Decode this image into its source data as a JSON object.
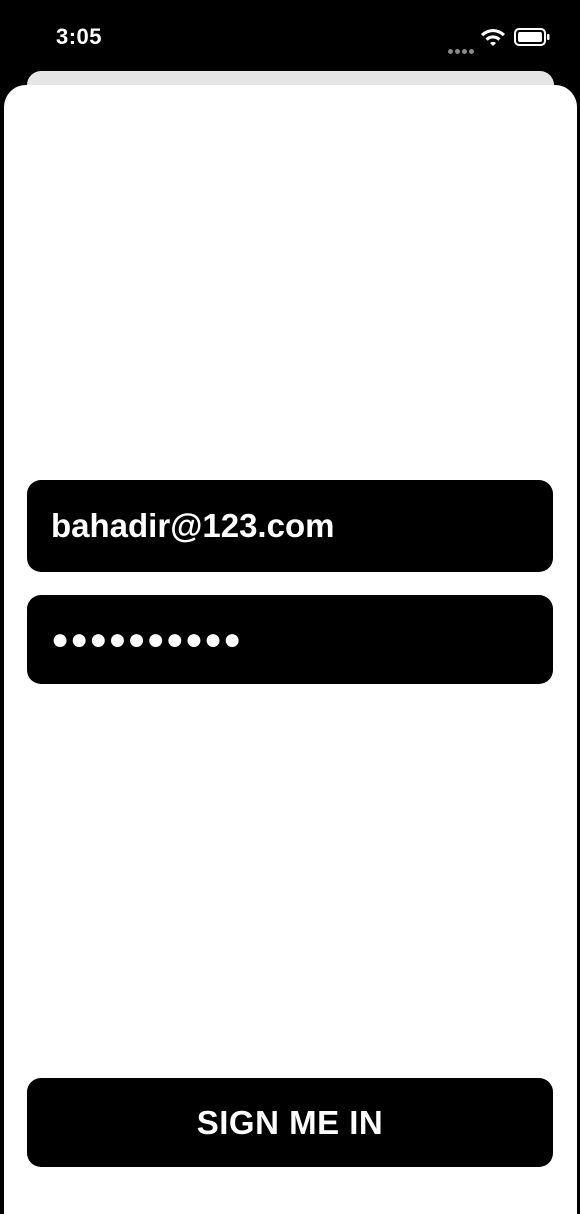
{
  "status_bar": {
    "time": "3:05",
    "wifi_icon": "wifi-icon",
    "battery_icon": "battery-icon"
  },
  "login_form": {
    "email_value": "bahadir@123.com",
    "password_mask": "●●●●●●●●●●",
    "sign_in_label": "SIGN ME IN"
  }
}
